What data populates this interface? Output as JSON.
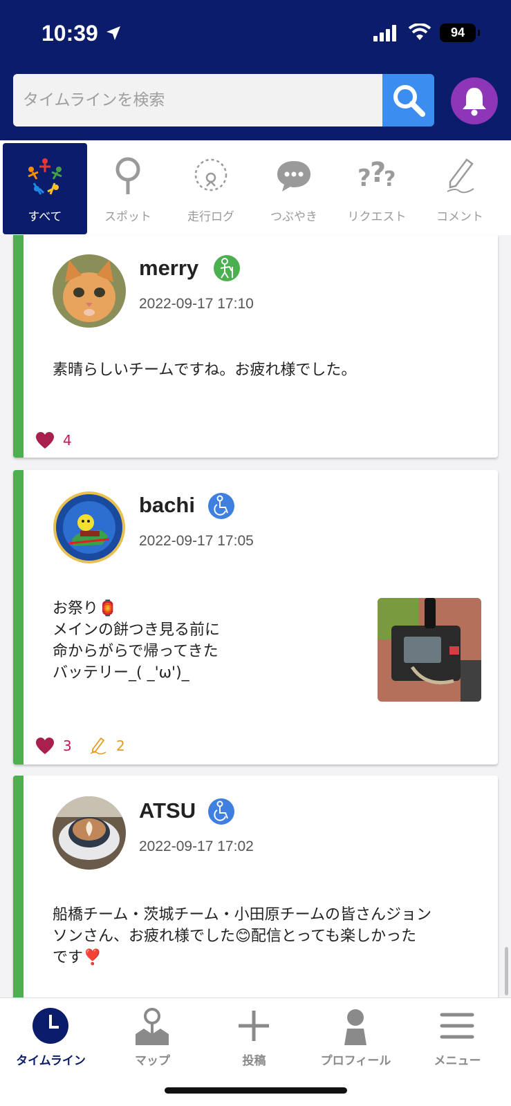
{
  "status_bar": {
    "time": "10:39",
    "battery": "94"
  },
  "search": {
    "placeholder": "タイムラインを検索"
  },
  "tabs": [
    {
      "label": "すべて",
      "icon": "people-circle-icon"
    },
    {
      "label": "スポット",
      "icon": "spot-pin-icon"
    },
    {
      "label": "走行ログ",
      "icon": "route-log-icon"
    },
    {
      "label": "つぶやき",
      "icon": "speech-bubble-icon"
    },
    {
      "label": "リクエスト",
      "icon": "question-icon"
    },
    {
      "label": "コメント",
      "icon": "pencil-icon"
    }
  ],
  "posts": [
    {
      "user": "merry",
      "role_icon": "walker-icon",
      "date": "2022-09-17 17:10",
      "text": "素晴らしいチームですね。お疲れ様でした。",
      "likes": "4",
      "comments": ""
    },
    {
      "user": "bachi",
      "role_icon": "wheelchair-icon",
      "date": "2022-09-17 17:05",
      "text": "お祭り🏮\nメインの餅つき見る前に\n命からがらで帰ってきた\nバッテリー_( _'ω')_",
      "likes": "3",
      "comments": "2"
    },
    {
      "user": "ATSU",
      "role_icon": "wheelchair-icon",
      "date": "2022-09-17 17:02",
      "text": "船橋チーム・茨城チーム・小田原チームの皆さんジョン\nソンさん、お疲れ様でした😊配信とっても楽しかった\nです❣️",
      "likes": "",
      "comments": ""
    }
  ],
  "bottom_nav": [
    {
      "label": "タイムライン",
      "icon": "clock-icon"
    },
    {
      "label": "マップ",
      "icon": "map-icon"
    },
    {
      "label": "投稿",
      "icon": "plus-icon"
    },
    {
      "label": "プロフィール",
      "icon": "person-icon"
    },
    {
      "label": "メニュー",
      "icon": "hamburger-icon"
    }
  ],
  "colors": {
    "header_bg": "#0a1c6a",
    "search_btn": "#3b8df0",
    "bell_btn": "#8e35b8",
    "card_accent": "#4caf50",
    "like": "#c2185b",
    "comment": "#e69a1f"
  }
}
